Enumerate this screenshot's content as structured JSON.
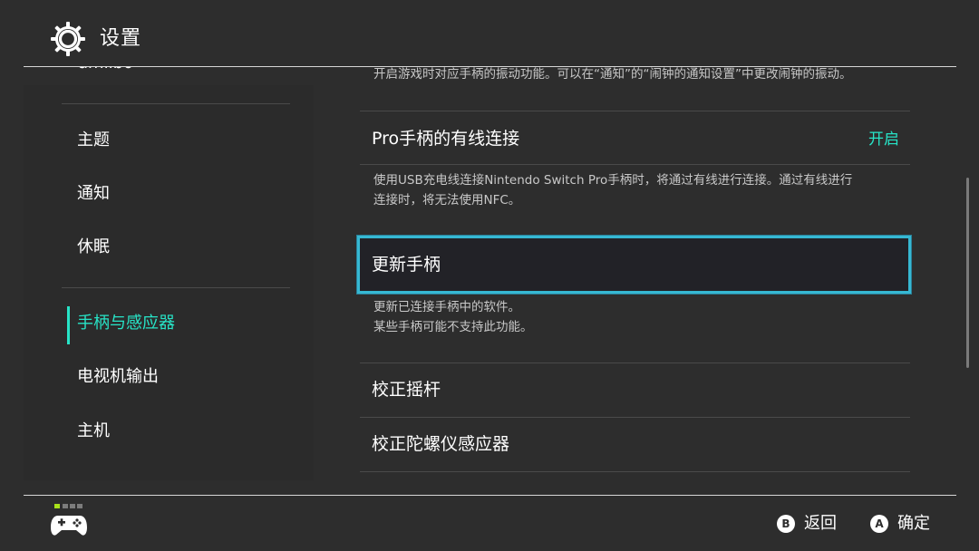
{
  "header": {
    "title": "设置",
    "icon": "gear-icon"
  },
  "sidebar": {
    "cut_item": "amiibo",
    "items": [
      {
        "label": "主题",
        "active": false
      },
      {
        "label": "通知",
        "active": false
      },
      {
        "label": "休眠",
        "active": false
      },
      {
        "label": "手柄与感应器",
        "active": true
      },
      {
        "label": "电视机输出",
        "active": false
      },
      {
        "label": "主机",
        "active": false
      }
    ]
  },
  "main": {
    "top_desc": "开启游戏时对应手柄的振动功能。可以在“通知”的“闹钟的通知设置”中更改闹钟的振动。",
    "pro_wired": {
      "label": "Pro手柄的有线连接",
      "value": "开启",
      "desc_line1": "使用USB充电线连接Nintendo Switch Pro手柄时，将通过有线进行连接。通过有线进行",
      "desc_line2": "连接时，将无法使用NFC。"
    },
    "update": {
      "label": "更新手柄",
      "desc_line1": "更新已连接手柄中的软件。",
      "desc_line2": "某些手柄可能不支持此功能。"
    },
    "calibrate_stick": {
      "label": "校正摇杆"
    },
    "calibrate_gyro": {
      "label": "校正陀螺仪感应器"
    }
  },
  "footer": {
    "controller_icon": "controller-icon",
    "back": {
      "key": "B",
      "label": "返回"
    },
    "confirm": {
      "key": "A",
      "label": "确定"
    }
  },
  "colors": {
    "background": "#2d2d2d",
    "accent": "#27e4c7",
    "focus_border": "#36b8d3",
    "player_indicator": "#a9e21a"
  }
}
